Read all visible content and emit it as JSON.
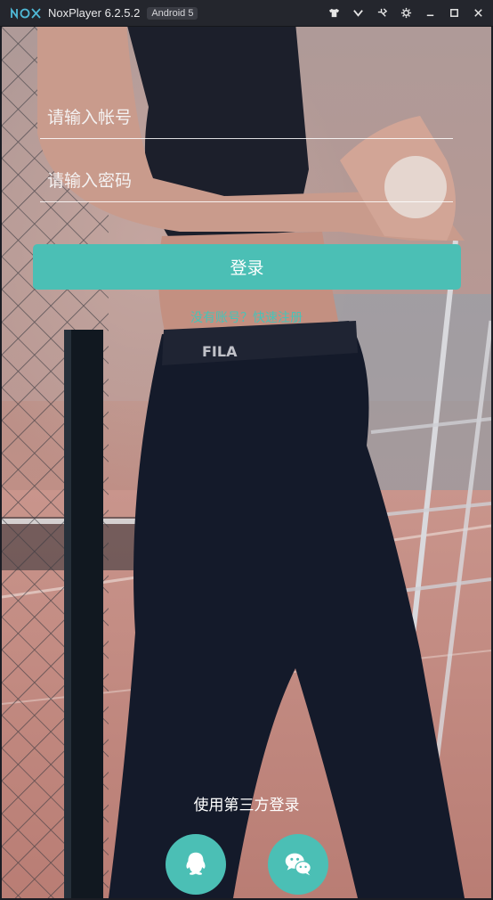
{
  "window": {
    "app_title": "NoxPlayer 6.2.5.2",
    "android_badge": "Android 5",
    "controls": [
      "shirt-icon",
      "chevron-down-icon",
      "pin-icon",
      "gear-icon",
      "minimize-icon",
      "maximize-icon",
      "close-icon"
    ]
  },
  "login": {
    "account_placeholder": "请输入帐号",
    "password_placeholder": "请输入密码",
    "login_label": "登录",
    "register_link": "没有账号？快速注册",
    "third_party_label": "使用第三方登录"
  },
  "social": [
    "qq-icon",
    "wechat-icon"
  ],
  "colors": {
    "accent": "#4bbfb5",
    "link": "#47c3b8",
    "titlebar": "#24262d"
  }
}
